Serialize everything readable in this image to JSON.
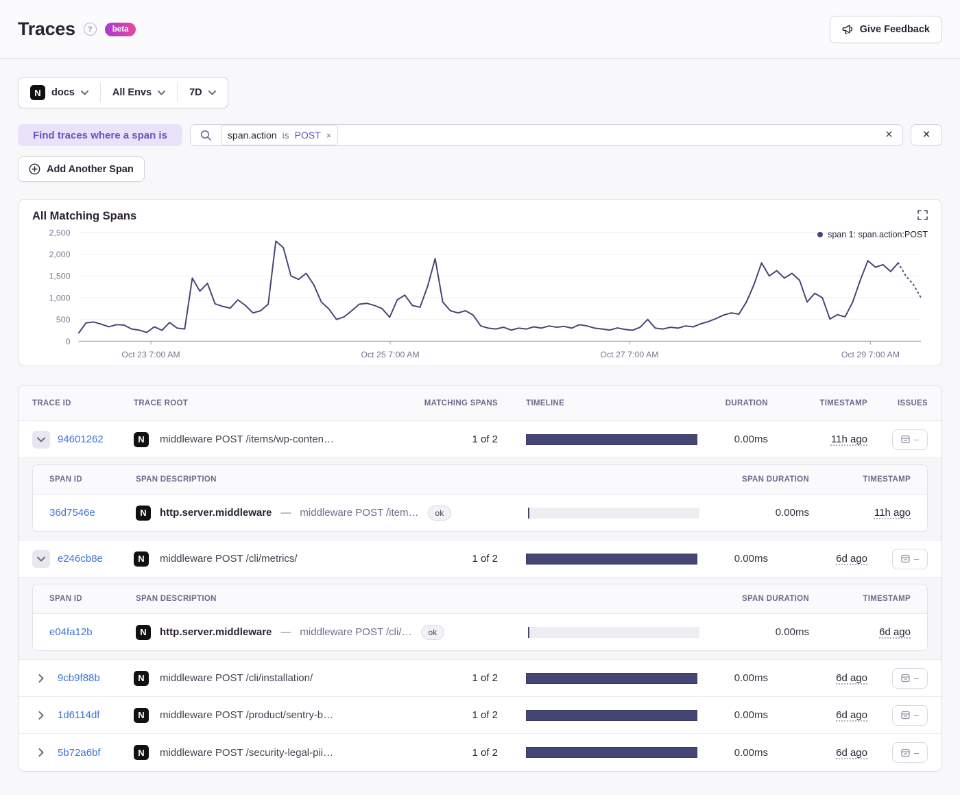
{
  "header": {
    "title": "Traces",
    "beta_label": "beta",
    "feedback_label": "Give Feedback"
  },
  "filters": {
    "project": "docs",
    "environment": "All Envs",
    "period": "7D"
  },
  "query": {
    "where_label": "Find traces where a span is",
    "token": {
      "key": "span.action",
      "op": "is",
      "value": "POST",
      "remove": "×"
    },
    "clear_label": "×",
    "close_label": "×",
    "add_span_label": "Add Another Span"
  },
  "chart": {
    "title": "All Matching Spans",
    "legend": "span 1: span.action:POST"
  },
  "chart_data": {
    "type": "line",
    "title": "All Matching Spans",
    "series_name": "span 1: span.action:POST",
    "legend_position": "top-right",
    "color": "#444674",
    "ylim": [
      0,
      2500
    ],
    "yticks": [
      "0",
      "500",
      "1,000",
      "1,500",
      "2,000",
      "2,500"
    ],
    "xticks": [
      "Oct 23 7:00 AM",
      "Oct 25 7:00 AM",
      "Oct 27 7:00 AM",
      "Oct 29 7:00 AM"
    ],
    "x_tick_fractions": [
      0.086,
      0.37,
      0.654,
      0.94
    ],
    "grid": true,
    "values": [
      180,
      420,
      440,
      390,
      330,
      380,
      370,
      280,
      255,
      200,
      330,
      250,
      430,
      300,
      280,
      1450,
      1150,
      1330,
      860,
      800,
      760,
      950,
      820,
      650,
      700,
      850,
      2300,
      2150,
      1500,
      1420,
      1560,
      1300,
      900,
      740,
      500,
      560,
      700,
      850,
      870,
      820,
      750,
      550,
      950,
      1060,
      820,
      780,
      1260,
      1900,
      900,
      700,
      650,
      700,
      600,
      350,
      300,
      280,
      320,
      255,
      300,
      280,
      330,
      300,
      350,
      320,
      340,
      300,
      380,
      350,
      300,
      280,
      255,
      305,
      270,
      250,
      320,
      500,
      300,
      280,
      320,
      300,
      350,
      330,
      400,
      450,
      520,
      600,
      650,
      620,
      900,
      1300,
      1800,
      1500,
      1620,
      1450,
      1560,
      1400,
      900,
      1100,
      1000,
      510,
      610,
      560,
      900,
      1400,
      1850,
      1700,
      1760,
      1600,
      1800,
      1500,
      1300,
      1000
    ]
  },
  "table": {
    "columns": [
      "TRACE ID",
      "TRACE ROOT",
      "MATCHING SPANS",
      "TIMELINE",
      "DURATION",
      "TIMESTAMP",
      "ISSUES"
    ],
    "span_columns": [
      "SPAN ID",
      "SPAN DESCRIPTION",
      "SPAN DURATION",
      "TIMESTAMP"
    ],
    "rows": [
      {
        "id": "94601262",
        "root": "middleware POST /items/wp-conten…",
        "matching": "1 of 2",
        "duration": "0.00ms",
        "timestamp": "11h ago",
        "spans": [
          {
            "id": "36d7546e",
            "op": "http.server.middleware",
            "sep": "—",
            "desc": "middleware POST /item…",
            "status": "ok",
            "duration": "0.00ms",
            "timestamp": "11h ago"
          }
        ]
      },
      {
        "id": "e246cb8e",
        "root": "middleware POST /cli/metrics/",
        "matching": "1 of 2",
        "duration": "0.00ms",
        "timestamp": "6d ago",
        "spans": [
          {
            "id": "e04fa12b",
            "op": "http.server.middleware",
            "sep": "—",
            "desc": "middleware POST /cli/…",
            "status": "ok",
            "duration": "0.00ms",
            "timestamp": "6d ago"
          }
        ]
      },
      {
        "id": "9cb9f88b",
        "root": "middleware POST /cli/installation/",
        "matching": "1 of 2",
        "duration": "0.00ms",
        "timestamp": "6d ago"
      },
      {
        "id": "1d6114df",
        "root": "middleware POST /product/sentry-b…",
        "matching": "1 of 2",
        "duration": "0.00ms",
        "timestamp": "6d ago"
      },
      {
        "id": "5b72a6bf",
        "root": "middleware POST /security-legal-pii…",
        "matching": "1 of 2",
        "duration": "0.00ms",
        "timestamp": "6d ago"
      }
    ]
  }
}
